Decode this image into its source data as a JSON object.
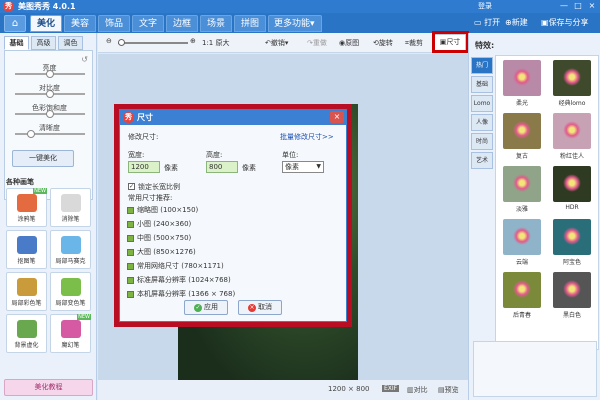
{
  "titlebar": {
    "title": "美图秀秀 4.0.1",
    "logo": "秀",
    "login": "登录",
    "minimize": "—",
    "maximize": "□",
    "close": "×"
  },
  "menubar": {
    "home_icon": "⌂",
    "items": [
      "美化",
      "美容",
      "饰品",
      "文字",
      "边框",
      "场景",
      "拼图",
      "更多功能"
    ],
    "more_arrow": "▾",
    "open": "打开",
    "new": "新建",
    "save_share": "保存与分享"
  },
  "left_panel": {
    "tabs": [
      "基础",
      "高级",
      "调色"
    ],
    "sliders": [
      {
        "label": "亮度",
        "value": 0.5
      },
      {
        "label": "对比度",
        "value": 0.5
      },
      {
        "label": "色彩饱和度",
        "value": 0.5
      },
      {
        "label": "清晰度",
        "value": 0.2
      }
    ],
    "one_click": "一键美化",
    "brush_title": "各种画笔",
    "brushes": [
      {
        "label": "涂鸦笔",
        "color": "#e46b3f",
        "badge": "NEW"
      },
      {
        "label": "消除笔",
        "color": "#d9d9d9"
      },
      {
        "label": "抠图笔",
        "color": "#4a7bc8"
      },
      {
        "label": "局部马赛克",
        "color": "#6bb6e8"
      },
      {
        "label": "局部彩色笔",
        "color": "#c99b3a"
      },
      {
        "label": "局部变色笔",
        "color": "#7bbf4a"
      },
      {
        "label": "背景虚化",
        "color": "#6aa84f"
      },
      {
        "label": "魔幻笔",
        "color": "#d65aa3",
        "badge": "NEW"
      }
    ],
    "tutorial": "美化教程"
  },
  "toolbar": {
    "zoom_in": "⊕",
    "zoom_out": "⊖",
    "actual_size": "1:1 原大",
    "undo": "撤销",
    "redo": "重做",
    "original": "原图",
    "rotate": "旋转",
    "crop": "裁剪",
    "size": "尺寸",
    "zoom_level": 0.0
  },
  "status": {
    "dimensions": "1200 × 800",
    "exif": "EXIF",
    "compare": "对比",
    "preview": "预览"
  },
  "right_panel": {
    "title": "特效:",
    "tabs": [
      "热门",
      "基础",
      "Lomo",
      "人像",
      "时尚",
      "艺术"
    ],
    "effects": [
      {
        "label": "柔光",
        "color": "#b88aa8"
      },
      {
        "label": "经典lomo",
        "color": "#3f4a2c"
      },
      {
        "label": "复古",
        "color": "#8a7a4a"
      },
      {
        "label": "粉红佳人",
        "color": "#c7a2b5"
      },
      {
        "label": "淡雅",
        "color": "#8fa488"
      },
      {
        "label": "HDR",
        "color": "#2e3a22"
      },
      {
        "label": "云端",
        "color": "#8fb4c9"
      },
      {
        "label": "阿宝色",
        "color": "#2a6e7a"
      },
      {
        "label": "后青春",
        "color": "#7a8a3a"
      },
      {
        "label": "黑白色",
        "color": "#555555"
      }
    ]
  },
  "dialog": {
    "title": "尺寸",
    "modify": "修改尺寸:",
    "batch": "批量修改尺寸>>",
    "width_label": "宽度:",
    "width_value": "1200",
    "height_label": "高度:",
    "height_value": "800",
    "unit_label": "单位:",
    "unit_value": "像素",
    "px1": "像素",
    "px2": "像素",
    "lock_ratio": "锁定长宽比例",
    "presets_title": "常用尺寸推荐:",
    "presets": [
      "缩略图 (100×150)",
      "小图 (240×360)",
      "中图 (500×750)",
      "大图 (850×1276)",
      "常用网络尺寸 (780×1171)",
      "标准屏幕分辨率 (1024×768)",
      "本机屏幕分辨率 (1366 × 768)"
    ],
    "apply": "应用",
    "cancel": "取消",
    "close": "×"
  }
}
